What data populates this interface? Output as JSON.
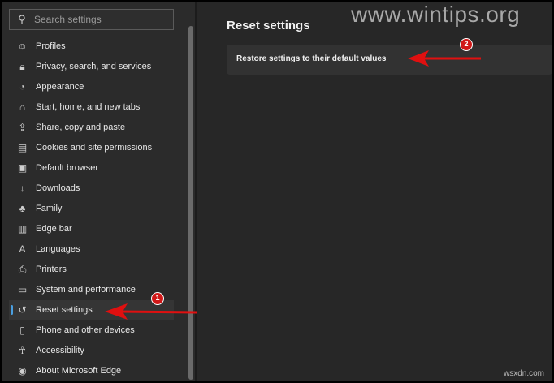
{
  "search": {
    "placeholder": "Search settings"
  },
  "sidebar": {
    "items": [
      {
        "label": "Profiles",
        "icon": "profile-icon"
      },
      {
        "label": "Privacy, search, and services",
        "icon": "lock-icon"
      },
      {
        "label": "Appearance",
        "icon": "palette-icon"
      },
      {
        "label": "Start, home, and new tabs",
        "icon": "home-icon"
      },
      {
        "label": "Share, copy and paste",
        "icon": "share-icon"
      },
      {
        "label": "Cookies and site permissions",
        "icon": "cookie-icon"
      },
      {
        "label": "Default browser",
        "icon": "browser-icon"
      },
      {
        "label": "Downloads",
        "icon": "download-icon"
      },
      {
        "label": "Family",
        "icon": "family-icon"
      },
      {
        "label": "Edge bar",
        "icon": "edge-bar-icon"
      },
      {
        "label": "Languages",
        "icon": "language-icon"
      },
      {
        "label": "Printers",
        "icon": "printer-icon"
      },
      {
        "label": "System and performance",
        "icon": "laptop-icon"
      },
      {
        "label": "Reset settings",
        "icon": "reset-icon",
        "selected": true
      },
      {
        "label": "Phone and other devices",
        "icon": "phone-icon"
      },
      {
        "label": "Accessibility",
        "icon": "accessibility-icon"
      },
      {
        "label": "About Microsoft Edge",
        "icon": "edge-logo-icon"
      }
    ]
  },
  "main": {
    "title": "Reset settings",
    "restore_label": "Restore settings to their default values"
  },
  "annotations": {
    "badge1": "1",
    "badge2": "2",
    "color": "#d01818"
  },
  "watermark": "www.wintips.org",
  "watermark2": "wsxdn.com"
}
